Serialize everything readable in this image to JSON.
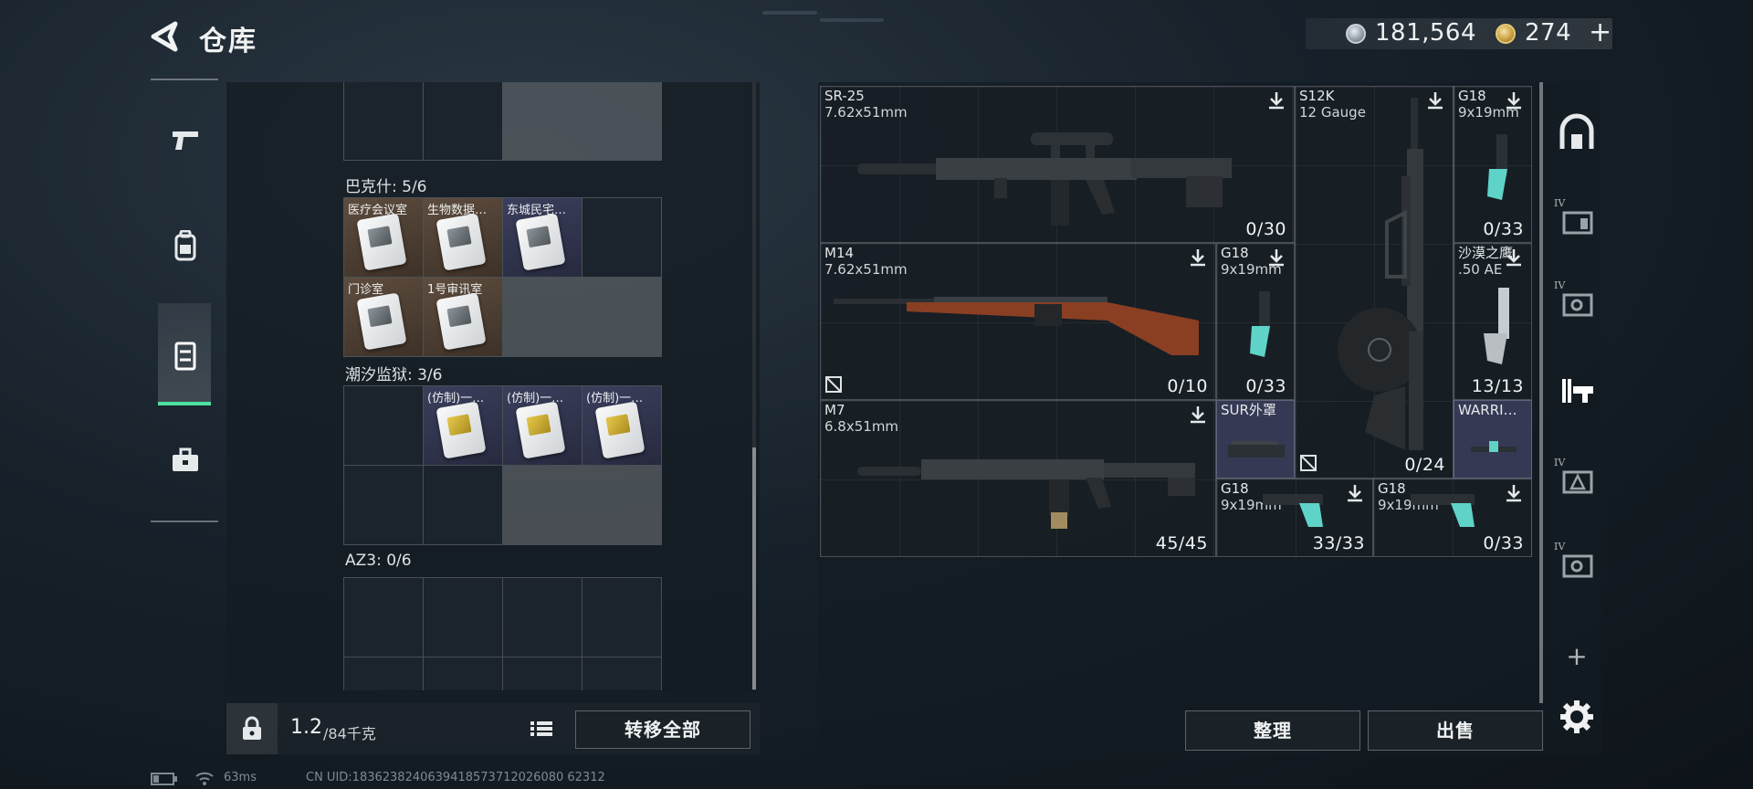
{
  "header": {
    "title": "仓库",
    "coin_value": "181,564",
    "gem_value": "274",
    "gem_add": "+"
  },
  "left_rail": [
    "firearms",
    "backpack",
    "storage",
    "toolbox"
  ],
  "storage": {
    "sections": [
      {
        "title": "巴克什: 5/6",
        "items": [
          "医疗会议室",
          "生物数据…",
          "东城民宅…",
          "门诊室",
          "1号审讯室"
        ]
      },
      {
        "title": "潮汐监狱: 3/6",
        "items": [
          "(仿制)一…",
          "(仿制)一…",
          "(仿制)一…"
        ]
      },
      {
        "title": "AZ3: 0/6"
      }
    ],
    "weight_current": "1.2",
    "weight_limit": "/84千克",
    "transfer_all": "转移全部"
  },
  "weapons": [
    {
      "name": "SR-25",
      "caliber": "7.62x51mm",
      "ammo": "0/30"
    },
    {
      "name": "S12K",
      "caliber": "12 Gauge",
      "ammo": "0/24"
    },
    {
      "name": "G18",
      "caliber": "9x19mm",
      "ammo": "0/33"
    },
    {
      "name": "M14",
      "caliber": "7.62x51mm",
      "ammo": "0/10"
    },
    {
      "name": "G18",
      "caliber": "9x19mm",
      "ammo": "0/33"
    },
    {
      "name": "沙漠之鹰",
      "caliber": ".50 AE",
      "ammo": "13/13"
    },
    {
      "name": "M7",
      "caliber": "6.8x51mm",
      "ammo": "45/45"
    },
    {
      "name": "SUR外罩"
    },
    {
      "name": "WARRI…"
    },
    {
      "name": "G18",
      "caliber": "9x19mm",
      "ammo": "33/33"
    },
    {
      "name": "G18",
      "caliber": "9x19mm",
      "ammo": "0/33"
    }
  ],
  "actions": {
    "sort": "整理",
    "sell": "出售"
  },
  "right_tabs": {
    "tab_iv_label": "IV",
    "add": "+"
  },
  "status": {
    "ping": "63ms",
    "uid": "CN UID:1836238240639418573712026080 62312"
  },
  "colors": {
    "accent_green": "#4ee0a0",
    "teal_grip": "#5fd3c8",
    "cell_purple": "#3b3f5d",
    "cell_brown": "#5e4d3e"
  }
}
